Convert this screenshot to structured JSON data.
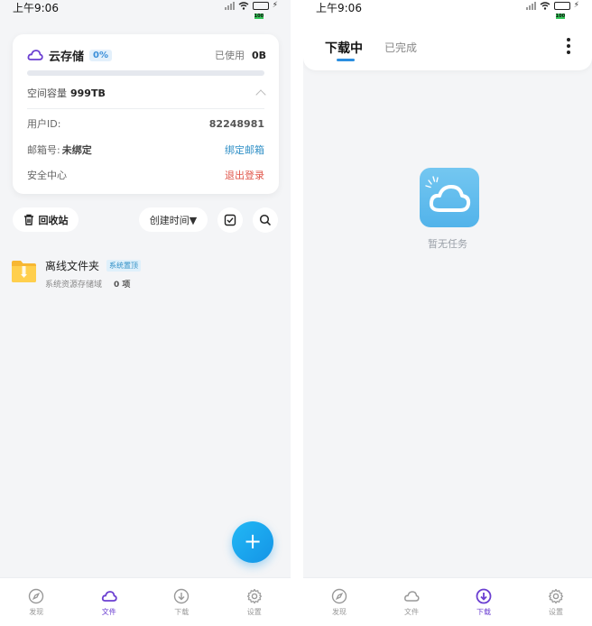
{
  "left": {
    "status": {
      "time": "上午9:06",
      "battery": "100"
    },
    "storage": {
      "title": "云存储",
      "percent": "0%",
      "used_label": "已使用",
      "used_value": "0B",
      "usage_fraction": 0,
      "capacity_label": "空间容量",
      "capacity_value": "999TB",
      "user_id_label": "用户ID:",
      "user_id_value": "82248981",
      "email_label": "邮箱号:",
      "email_value": "未绑定",
      "bind_email": "绑定邮箱",
      "security_label": "安全中心",
      "logout": "退出登录"
    },
    "toolbar": {
      "recycle": "回收站",
      "sort": "创建时间▼"
    },
    "folder": {
      "name": "离线文件夹",
      "tag": "系统置顶",
      "sub": "系统资源存储域",
      "count": "0 项"
    },
    "fab": "+",
    "nav": [
      "发现",
      "文件",
      "下载",
      "设置"
    ],
    "active_nav": 1
  },
  "right": {
    "status": {
      "time": "上午9:06",
      "battery": "100"
    },
    "tabs": [
      "下载中",
      "已完成"
    ],
    "empty": "暂无任务",
    "nav": [
      "发现",
      "文件",
      "下载",
      "设置"
    ],
    "active_nav": 2
  },
  "colors": {
    "accent": "#6b3fd1",
    "blue": "#2b8ee0",
    "danger": "#e0564a",
    "fab": "#1494e6"
  }
}
